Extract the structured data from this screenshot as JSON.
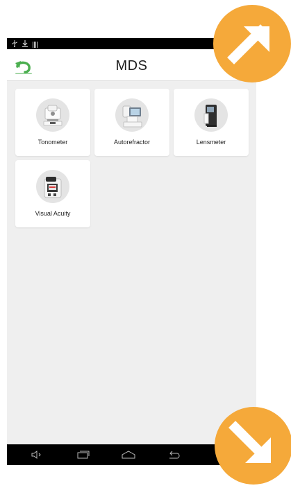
{
  "status_bar": {
    "icons": [
      "usb-icon",
      "download-icon",
      "signal-bars-icon"
    ]
  },
  "app_bar": {
    "title": "MDS",
    "back_icon": "back-arrow-icon",
    "back_color": "#4caf50"
  },
  "devices": [
    {
      "label": "Tonometer",
      "icon": "tonometer-device-icon"
    },
    {
      "label": "Autorefractor",
      "icon": "autorefractor-device-icon"
    },
    {
      "label": "Lensmeter",
      "icon": "lensmeter-device-icon"
    },
    {
      "label": "Visual Acuity",
      "icon": "visual-acuity-device-icon"
    }
  ],
  "nav_bar": {
    "buttons": [
      "volume-down-icon",
      "recent-apps-icon",
      "home-icon",
      "back-nav-icon"
    ]
  },
  "overlays": {
    "accent_color": "#f5a93a",
    "top_icon": "arrow-up-right-icon",
    "bottom_icon": "arrow-down-right-icon"
  }
}
